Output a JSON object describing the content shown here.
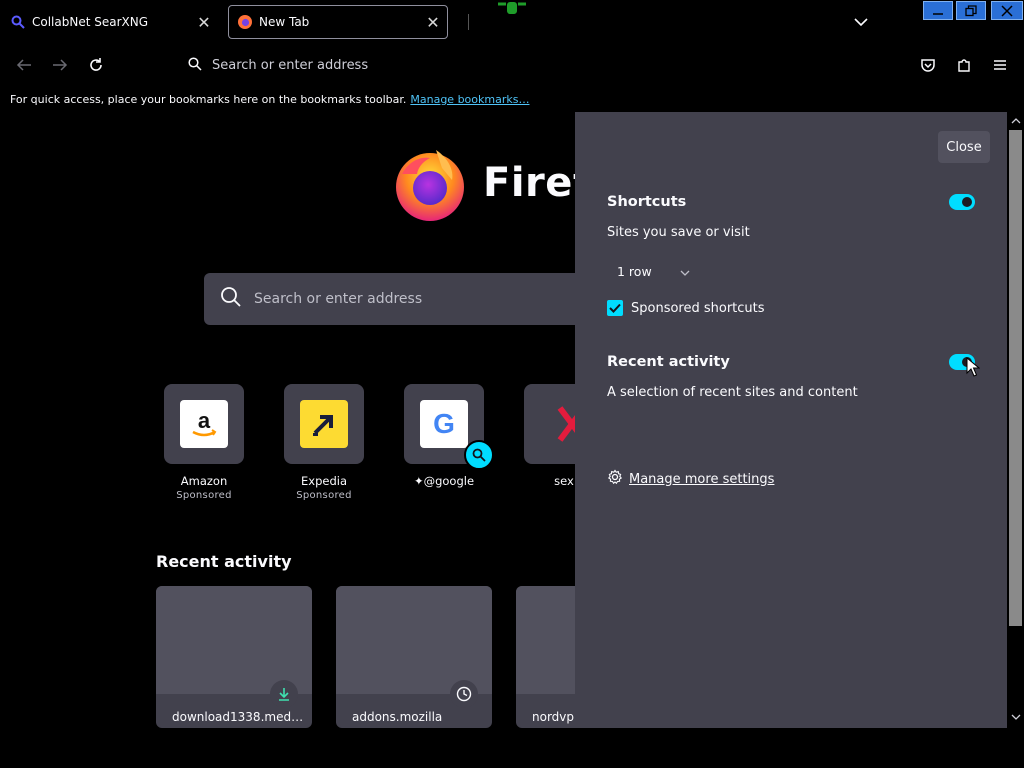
{
  "tabs": [
    {
      "title": "CollabNet SearXNG",
      "active": false
    },
    {
      "title": "New Tab",
      "active": true
    }
  ],
  "toolbar": {
    "url_placeholder": "Search or enter address"
  },
  "bookmarks_bar": {
    "message": "For quick access, place your bookmarks here on the bookmarks toolbar.",
    "link": "Manage bookmarks…"
  },
  "newtab": {
    "wordmark": "Firefox",
    "search_placeholder": "Search or enter address",
    "shortcuts": [
      {
        "name": "Amazon",
        "sponsored": "Sponsored"
      },
      {
        "name": "Expedia",
        "sponsored": "Sponsored"
      },
      {
        "name": "@google",
        "sponsored": ""
      },
      {
        "name": "sex",
        "sponsored": ""
      }
    ],
    "recent_heading": "Recent activity",
    "recent_cards": [
      {
        "label": "download1338.med…",
        "icon": "download-icon"
      },
      {
        "label": "addons.mozilla",
        "icon": "clock-icon"
      },
      {
        "label": "nordvp",
        "icon": ""
      }
    ]
  },
  "customize_panel": {
    "close_label": "Close",
    "shortcuts": {
      "title": "Shortcuts",
      "subtitle": "Sites you save or visit",
      "enabled": true,
      "rows_value": "1 row",
      "sponsored_label": "Sponsored shortcuts",
      "sponsored_checked": true
    },
    "recent_activity": {
      "title": "Recent activity",
      "subtitle": "A selection of recent sites and content",
      "enabled": true
    },
    "manage_more": "Manage more settings"
  },
  "colors": {
    "accent": "#00ddff",
    "panel_bg": "#42414d",
    "link": "#4fc3f7"
  }
}
